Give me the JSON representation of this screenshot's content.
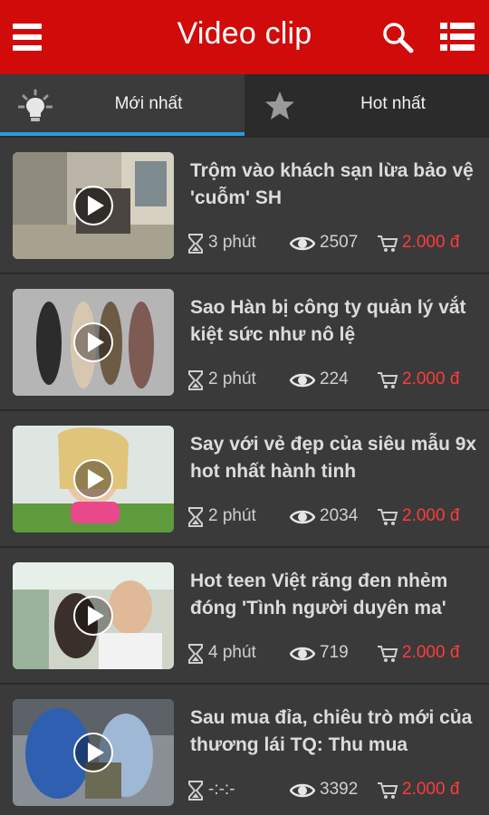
{
  "header": {
    "title": "Video clip",
    "icons": [
      "menu-icon",
      "search-icon",
      "list-icon"
    ]
  },
  "tabs": [
    {
      "label": "Mới nhất",
      "icon": "lightbulb-icon",
      "active": true
    },
    {
      "label": "Hot nhất",
      "icon": "star-icon",
      "active": false
    }
  ],
  "colors": {
    "header": "#d10a0a",
    "tab_indicator": "#2a9be0",
    "price": "#ff3b3b",
    "background": "#3a3a3a"
  },
  "videos": [
    {
      "title": "Trộm vào khách sạn lừa bảo vệ 'cuỗm' SH",
      "duration": "3 phút",
      "views": "2507",
      "price": "2.000 đ"
    },
    {
      "title": "Sao Hàn bị công ty quản lý vắt kiệt sức như nô lệ",
      "duration": "2 phút",
      "views": "224",
      "price": "2.000 đ"
    },
    {
      "title": "Say với vẻ đẹp của siêu mẫu 9x hot nhất hành tinh",
      "duration": "2 phút",
      "views": "2034",
      "price": "2.000 đ"
    },
    {
      "title": "Hot teen Việt răng đen nhẻm đóng 'Tình người duyên ma'",
      "duration": "4 phút",
      "views": "719",
      "price": "2.000 đ"
    },
    {
      "title": "Sau mua đỉa, chiêu trò mới của thương lái TQ: Thu mua",
      "duration": "-:-:-",
      "views": "3392",
      "price": "2.000 đ"
    }
  ]
}
